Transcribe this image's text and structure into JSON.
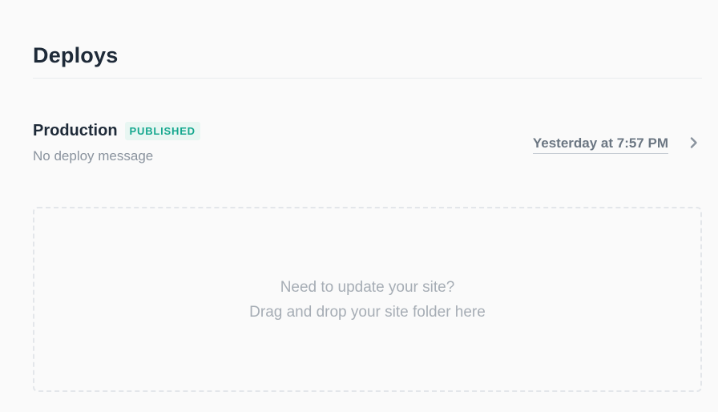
{
  "header": {
    "title": "Deploys"
  },
  "production": {
    "label": "Production",
    "badge": "PUBLISHED",
    "message": "No deploy message",
    "timestamp": "Yesterday at 7:57 PM",
    "chevron_icon": "chevron-right-icon"
  },
  "dropzone": {
    "line1": "Need to update your site?",
    "line2": "Drag and drop your site folder here"
  },
  "colors": {
    "badge_text": "#16a88f",
    "badge_bg": "#e8f6f2",
    "title": "#1e2a38"
  }
}
